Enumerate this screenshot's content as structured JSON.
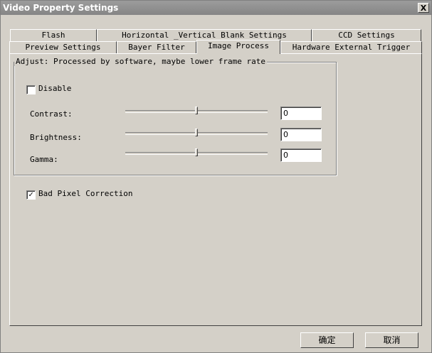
{
  "window": {
    "title": "Video Property Settings",
    "close_glyph": "X"
  },
  "tabs_row1": [
    {
      "label": "Flash"
    },
    {
      "label": "Horizontal _Vertical Blank Settings"
    },
    {
      "label": "CCD Settings"
    }
  ],
  "tabs_row2": [
    {
      "label": "Preview Settings"
    },
    {
      "label": "Bayer Filter"
    },
    {
      "label": "Image Process",
      "active": true
    },
    {
      "label": "Hardware External Trigger"
    }
  ],
  "adjust_group": {
    "legend": "Adjust: Processed by software, maybe lower frame rate",
    "disable": {
      "label": "Disable",
      "checked": false
    },
    "contrast": {
      "label": "Contrast:",
      "value": "0"
    },
    "brightness": {
      "label": "Brightness:",
      "value": "0"
    },
    "gamma": {
      "label": "Gamma:",
      "value": "0"
    }
  },
  "bad_pixel": {
    "label": "Bad Pixel Correction",
    "checked": true,
    "check_glyph": "✓"
  },
  "buttons": {
    "ok": "确定",
    "cancel": "取消"
  }
}
